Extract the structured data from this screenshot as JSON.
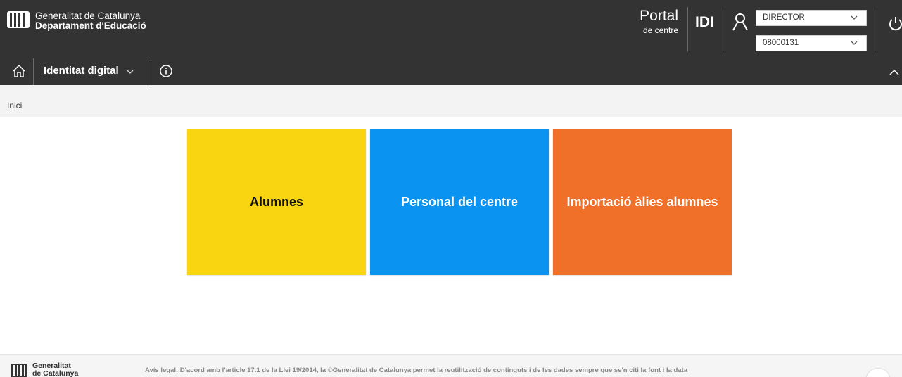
{
  "header": {
    "brand_line1": "Generalitat de Catalunya",
    "brand_line2": "Departament d'Educació",
    "portal_title": "Portal",
    "portal_subtitle": "de centre",
    "app_code": "IDI",
    "role_select": {
      "value": "DIRECTOR"
    },
    "center_select": {
      "value": "08000131"
    },
    "bg_color": "#333333"
  },
  "menubar": {
    "app_title": "Identitat digital",
    "icons": [
      "home-icon",
      "chevron-down-icon",
      "info-icon",
      "chevron-up-icon"
    ]
  },
  "breadcrumb": {
    "current": "Inici"
  },
  "tiles": [
    {
      "label": "Alumnes",
      "bg": "#f9d511",
      "fg": "#111111"
    },
    {
      "label": "Personal del centre",
      "bg": "#0a93f0",
      "fg": "#ffffff"
    },
    {
      "label": "Importació àlies alumnes",
      "bg": "#f0702a",
      "fg": "#ffffff"
    }
  ],
  "footer": {
    "brand_line1": "Generalitat",
    "brand_line2": "de Catalunya",
    "legal": "Avís legal: D'acord amb l'article 17.1 de la Llei 19/2014, la ©Generalitat de Catalunya permet la reutilització de continguts i de les dades sempre que se'n citi la font i la data"
  }
}
